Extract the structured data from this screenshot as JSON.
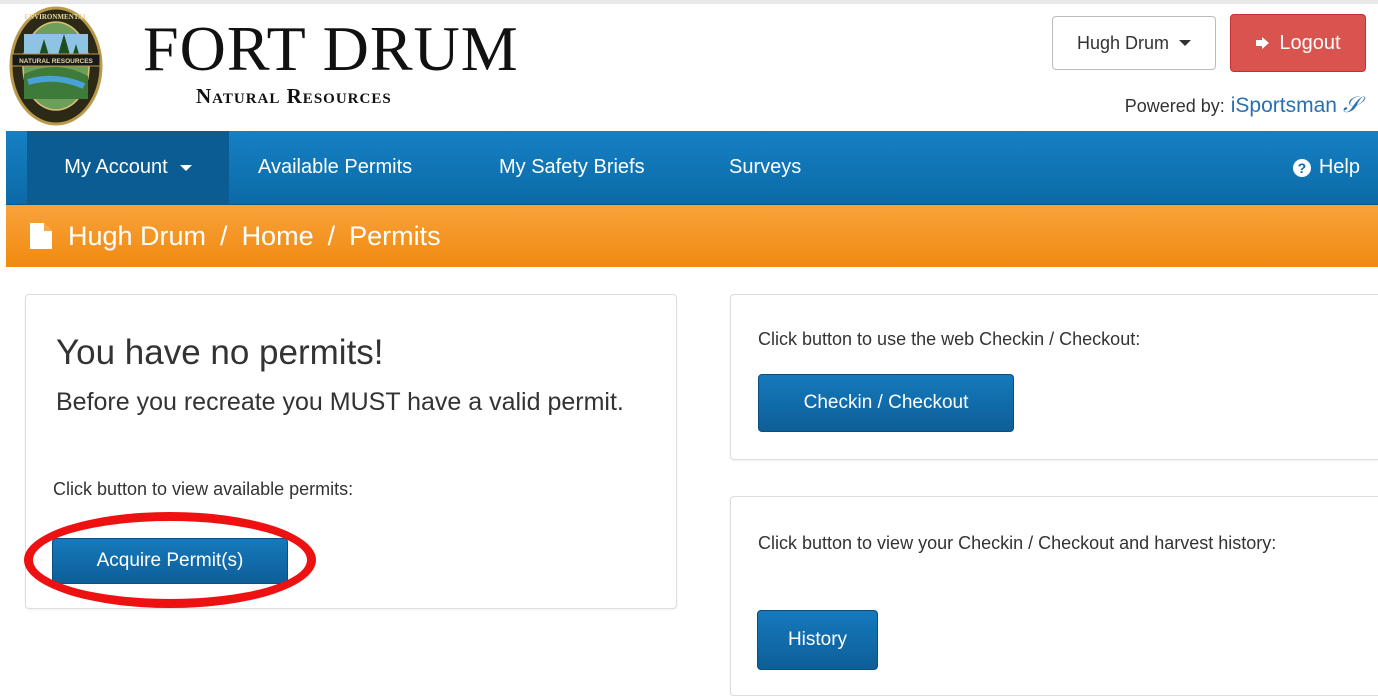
{
  "header": {
    "brand_title": "FORT DRUM",
    "brand_subtitle": "Natural Resources",
    "seal_text_top": "ENVIRONMENTAL",
    "seal_text_left": "NATURAL RESOURCES",
    "user_menu_label": "Hugh Drum",
    "logout_label": "Logout",
    "powered_by_label": "Powered by:",
    "powered_by_link": "iSportsman",
    "colors": {
      "logout": "#d9534f",
      "link": "#2a6fb0"
    }
  },
  "nav": {
    "items": [
      {
        "label": "My Account",
        "icon": "chevron-down-icon"
      },
      {
        "label": "Available Permits"
      },
      {
        "label": "My Safety Briefs"
      },
      {
        "label": "Surveys"
      }
    ],
    "help_label": "Help",
    "colors": {
      "bar": "#0b6aa7",
      "active": "#0a5c92"
    }
  },
  "breadcrumb": {
    "icon": "document-icon",
    "items": [
      "Hugh Drum",
      "Home",
      "Permits"
    ],
    "separator": "/",
    "color": "#f39018"
  },
  "permits_panel": {
    "title": "You have no permits!",
    "subtitle": "Before you recreate you MUST have a valid permit.",
    "instruction": "Click button to view available permits:",
    "button_label": "Acquire Permit(s)",
    "highlight_color": "#ee1111"
  },
  "checkin_panel": {
    "instruction": "Click button to use the web Checkin / Checkout:",
    "button_label": "Checkin / Checkout"
  },
  "history_panel": {
    "instruction": "Click button to view your Checkin / Checkout and harvest history:",
    "button_label": "History"
  }
}
